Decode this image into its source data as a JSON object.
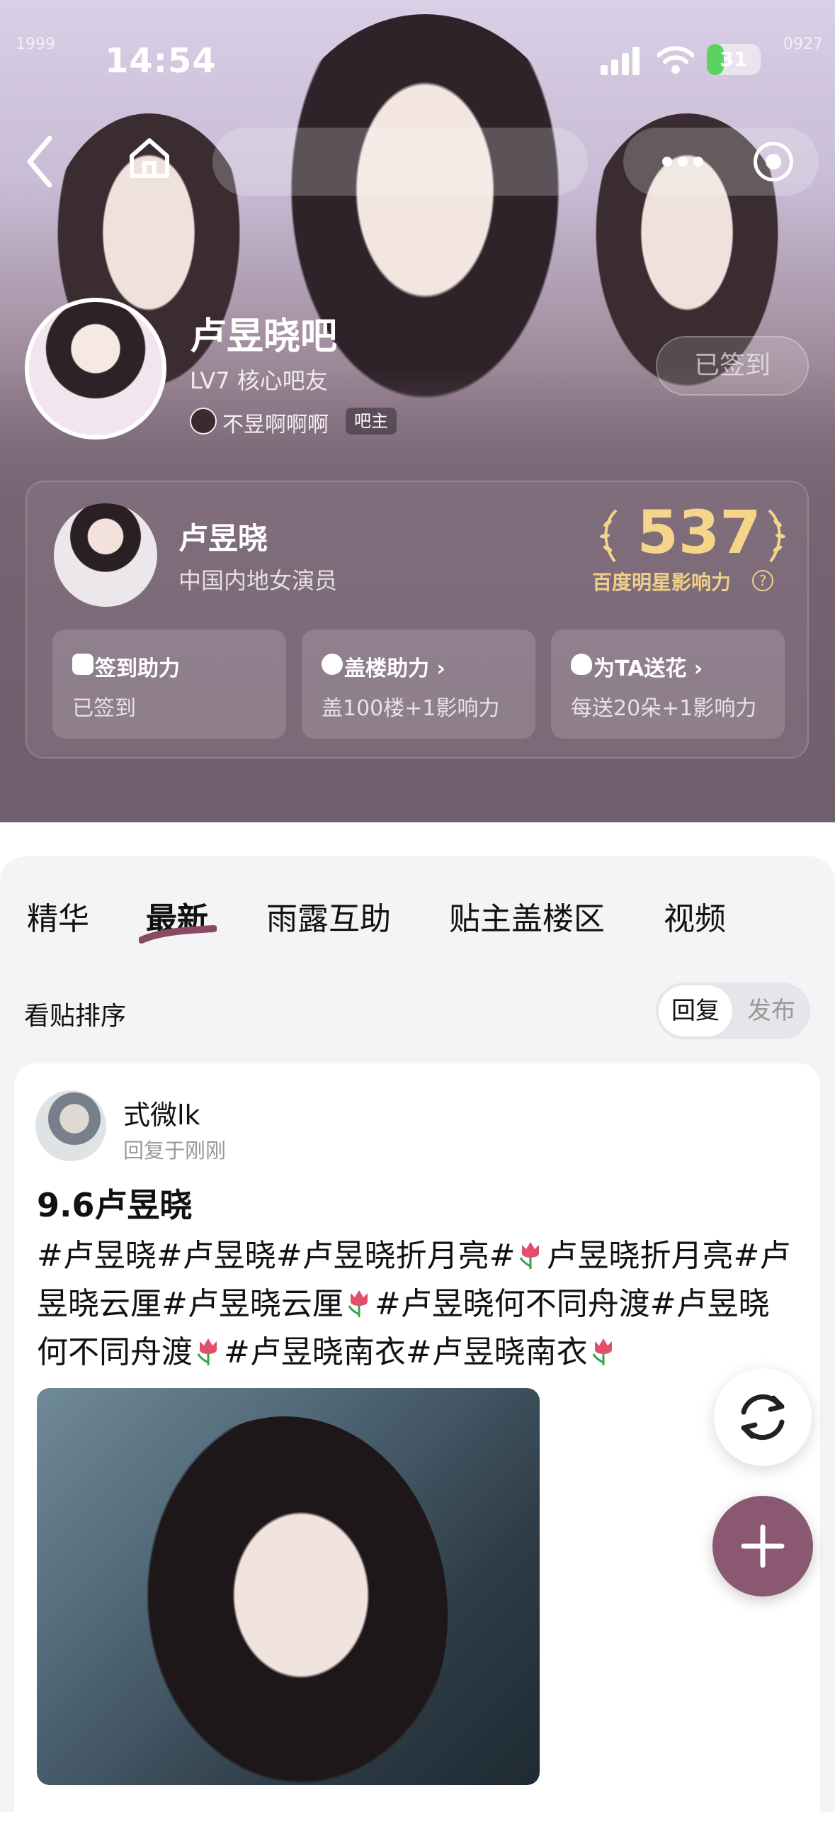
{
  "status_bar": {
    "time": "14:54",
    "battery": "31",
    "battery_level": 0.31
  },
  "hero_corner": {
    "left": "1999",
    "right": "0927"
  },
  "forum": {
    "name": "卢昱晓吧",
    "level": "LV7 核心吧友",
    "owner_name": "不昱啊啊啊",
    "owner_badge": "吧主",
    "signed_label": "已签到"
  },
  "star": {
    "name": "卢昱晓",
    "description": "中国内地女演员",
    "influence_value": "537",
    "influence_label": "百度明星影响力",
    "help_symbol": "?"
  },
  "actions": [
    {
      "title": "签到助力",
      "subtitle": "已签到",
      "icon": "calendar-icon"
    },
    {
      "title": "盖楼助力",
      "subtitle": "盖100楼+1影响力",
      "icon": "chat-bubble-icon"
    },
    {
      "title": "为TA送花",
      "subtitle": "每送20朵+1影响力",
      "icon": "flower-icon"
    }
  ],
  "tabs": [
    {
      "label": "精华"
    },
    {
      "label": "最新",
      "active": true
    },
    {
      "label": "雨露互助"
    },
    {
      "label": "贴主盖楼区"
    },
    {
      "label": "视频"
    }
  ],
  "sort": {
    "label": "看贴排序",
    "options": [
      "回复",
      "发布"
    ],
    "selected": "回复"
  },
  "post": {
    "username": "式微lk",
    "meta": "回复于刚刚",
    "title": "9.6卢昱晓",
    "body_parts": [
      "#卢昱晓#卢昱晓#卢昱晓折月亮#",
      "卢昱晓折月亮#卢昱晓云厘#卢昱晓云厘",
      "#卢昱晓何不同舟渡#卢昱晓何不同舟渡",
      "#卢昱晓南衣#卢昱晓南衣"
    ]
  },
  "colors": {
    "accent": "#8a5870",
    "gold": "#f5d58a",
    "tab_underline": "#8a4a63"
  }
}
